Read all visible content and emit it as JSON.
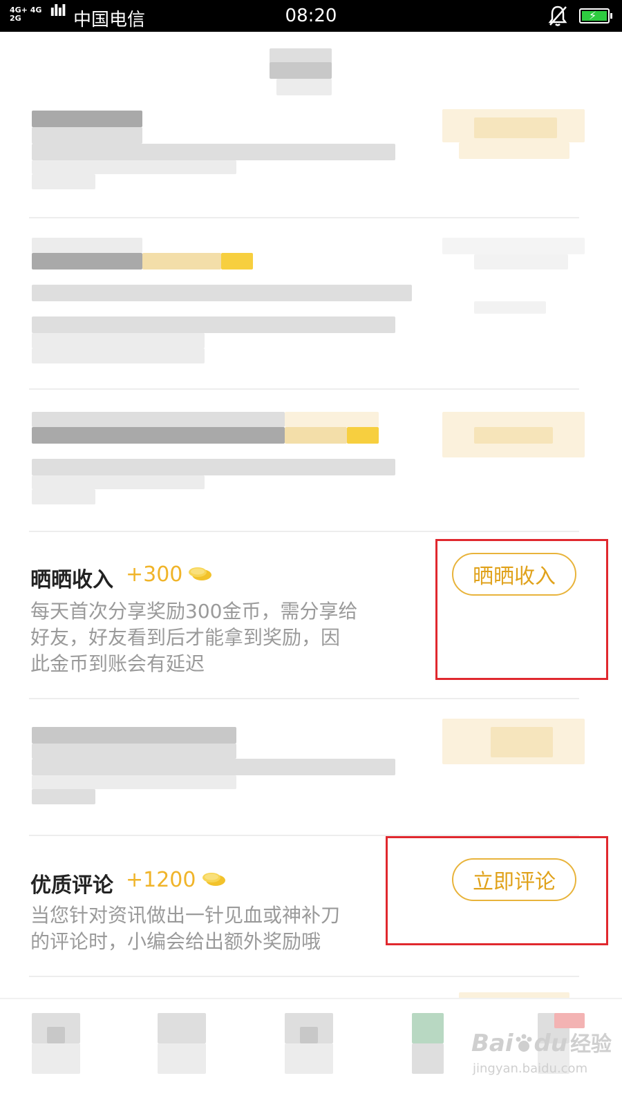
{
  "status_bar": {
    "network_top": "4G+ 4G",
    "network_bottom": "2G",
    "carrier": "中国电信",
    "time": "08:20"
  },
  "tasks": [
    {
      "title": "晒晒收入",
      "bonus": "+300",
      "description_lines": [
        "每天首次分享奖励300金币，需分享给",
        "好友，好友看到后才能拿到奖励，因",
        "此金币到账会有延迟"
      ],
      "button_label": "晒晒收入"
    },
    {
      "title": "优质评论",
      "bonus": "+1200",
      "description_lines": [
        "当您针对资讯做出一针见血或神补刀",
        "的评论时，小编会给出额外奖励哦"
      ],
      "button_label": "立即评论"
    }
  ],
  "watermark": {
    "brand": "Bai",
    "brand_suffix": "du",
    "product": "经验",
    "url": "jingyan.baidu.com"
  },
  "colors": {
    "accent": "#e8b33a",
    "highlight_box": "#e0282e",
    "description": "#9a9a9a"
  }
}
